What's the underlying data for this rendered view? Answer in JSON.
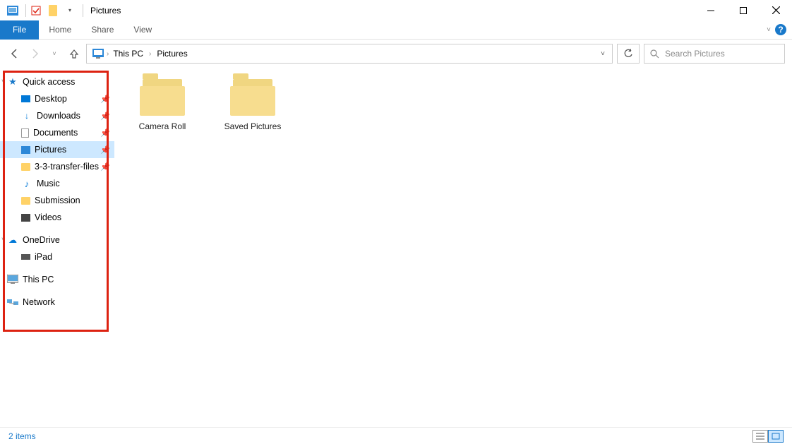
{
  "window": {
    "title": "Pictures"
  },
  "ribbon": {
    "file": "File",
    "tabs": [
      "Home",
      "Share",
      "View"
    ]
  },
  "breadcrumb": {
    "root": "This PC",
    "current": "Pictures"
  },
  "search": {
    "placeholder": "Search Pictures"
  },
  "sidebar": {
    "quick_access": {
      "label": "Quick access",
      "items": [
        {
          "label": "Desktop",
          "icon": "desktop",
          "pinned": true
        },
        {
          "label": "Downloads",
          "icon": "dl",
          "pinned": true
        },
        {
          "label": "Documents",
          "icon": "doc",
          "pinned": true
        },
        {
          "label": "Pictures",
          "icon": "pictures",
          "pinned": true,
          "selected": true
        },
        {
          "label": "3-3-transfer-files",
          "icon": "folder",
          "pinned": true
        },
        {
          "label": "Music",
          "icon": "music",
          "pinned": false
        },
        {
          "label": "Submission",
          "icon": "folder",
          "pinned": false
        },
        {
          "label": "Videos",
          "icon": "videos",
          "pinned": false
        }
      ]
    },
    "onedrive": {
      "label": "OneDrive",
      "items": [
        {
          "label": "iPad",
          "icon": "ipad"
        }
      ]
    },
    "thispc": {
      "label": "This PC"
    },
    "network": {
      "label": "Network"
    }
  },
  "content": {
    "folders": [
      {
        "label": "Camera Roll"
      },
      {
        "label": "Saved Pictures"
      }
    ]
  },
  "status": {
    "text": "2 items"
  }
}
